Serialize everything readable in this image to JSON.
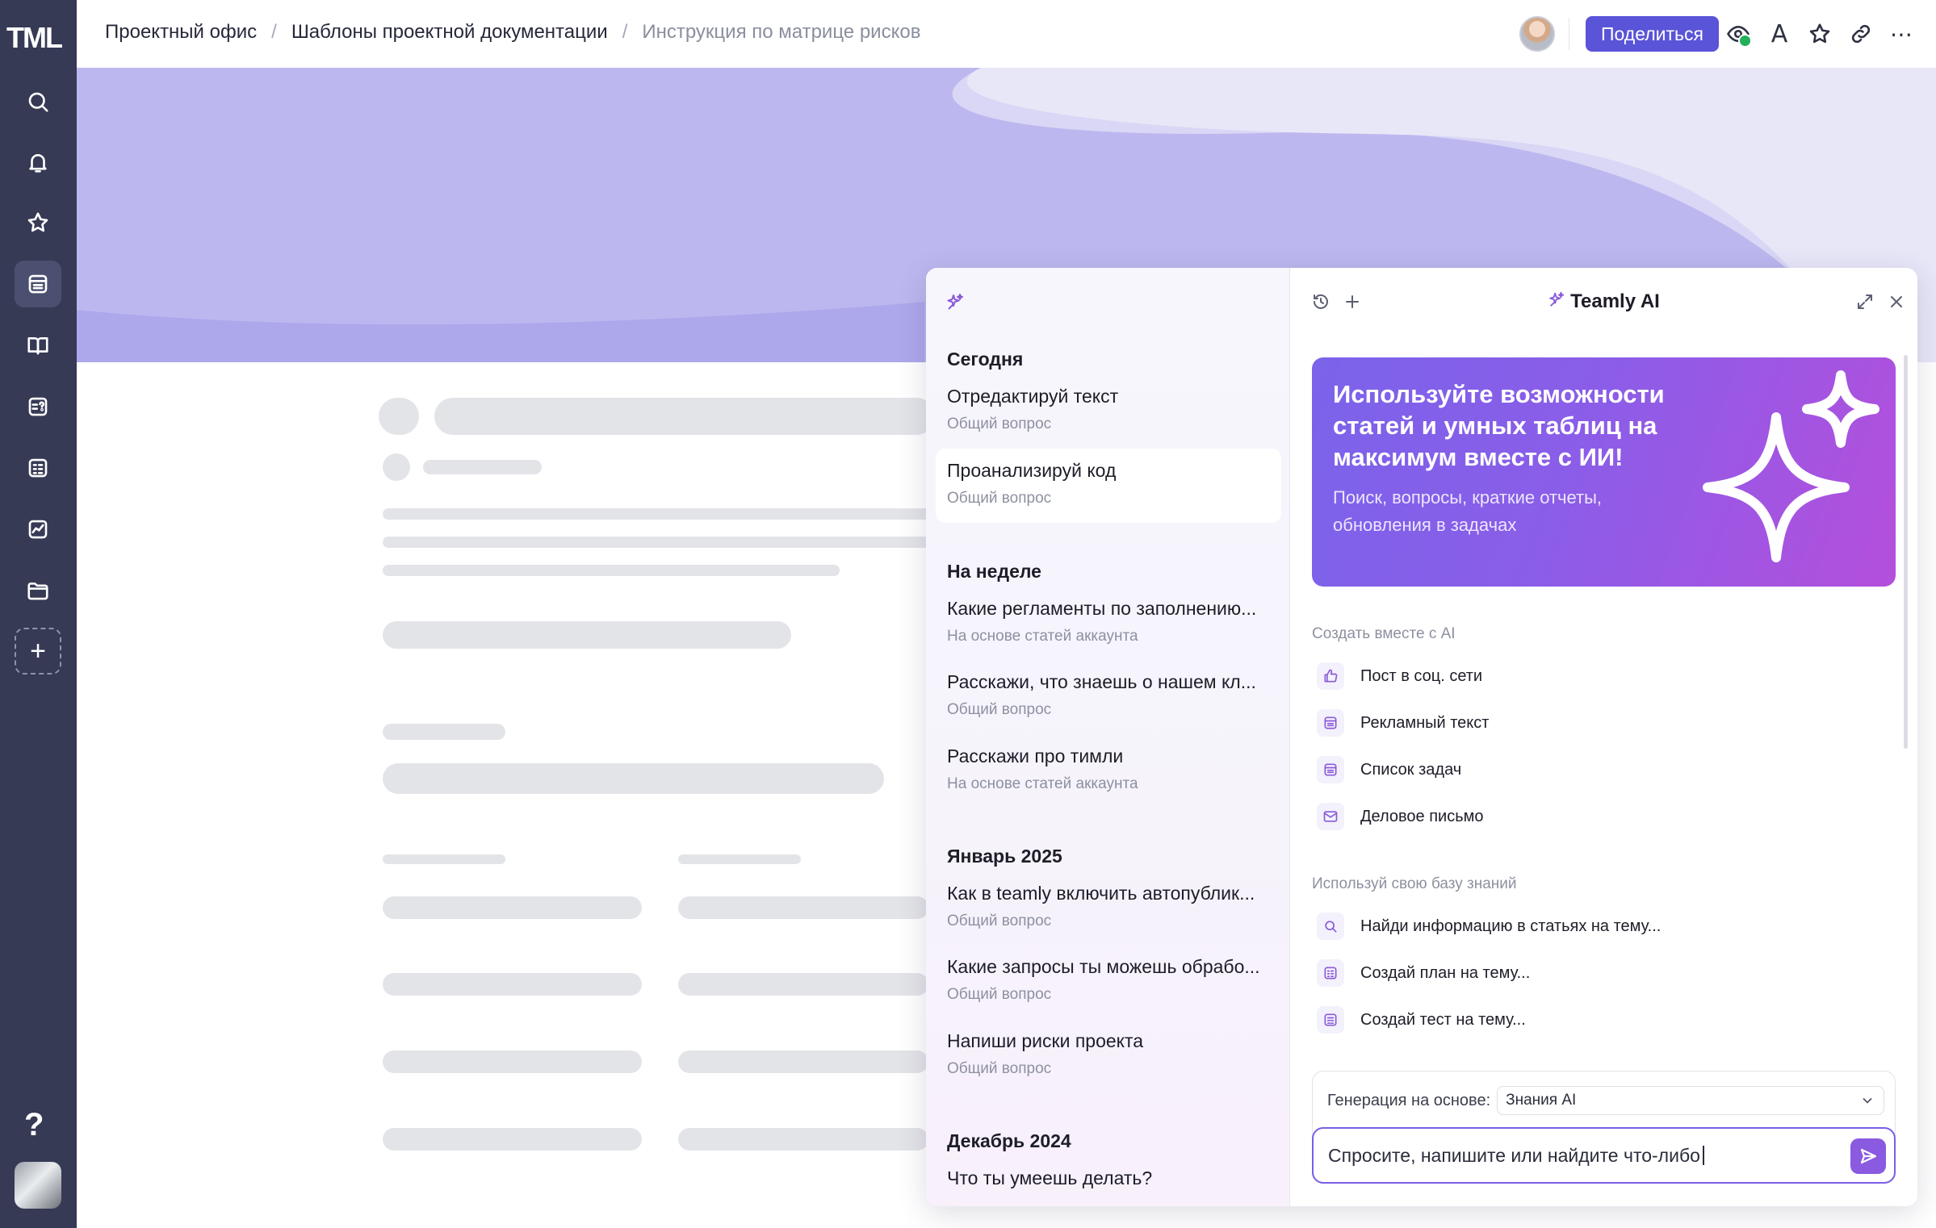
{
  "rail": {
    "logo": "TML",
    "help": "?",
    "add": "+",
    "icons": [
      "search-icon",
      "bell-icon",
      "star-icon",
      "spaces-icon",
      "book-icon",
      "quiz-icon",
      "table-icon",
      "chart-icon",
      "folder-icon"
    ]
  },
  "breadcrumb": {
    "items": [
      "Проектный офис",
      "Шаблоны проектной документации",
      "Инструкция по матрице рисков"
    ],
    "separator": "/"
  },
  "toolbar": {
    "share_label": "Поделиться",
    "text_icon_label": "A",
    "more_label": "⋯"
  },
  "ai": {
    "title": "Teamly AI",
    "history": [
      {
        "section": "Сегодня",
        "items": [
          {
            "title": "Отредактируй текст",
            "subtitle": "Общий вопрос"
          },
          {
            "title": "Проанализируй код",
            "subtitle": "Общий вопрос"
          }
        ]
      },
      {
        "section": "На неделе",
        "items": [
          {
            "title": "Какие регламенты по заполнению...",
            "subtitle": "На основе статей аккаунта"
          },
          {
            "title": "Расскажи, что знаешь о нашем кл...",
            "subtitle": "Общий вопрос"
          },
          {
            "title": "Расскажи про тимли",
            "subtitle": "На основе статей аккаунта"
          }
        ]
      },
      {
        "section": "Январь 2025",
        "items": [
          {
            "title": "Как в teamly включить автопублик...",
            "subtitle": "Общий вопрос"
          },
          {
            "title": "Какие запросы ты можешь обрабо...",
            "subtitle": "Общий вопрос"
          },
          {
            "title": "Напиши риски проекта",
            "subtitle": "Общий вопрос"
          }
        ]
      },
      {
        "section": "Декабрь 2024",
        "items": [
          {
            "title": "Что ты умеешь делать?",
            "subtitle": ""
          }
        ]
      }
    ],
    "promo": {
      "title": "Используйте возможности статей и умных таблиц на максимум вместе с ИИ!",
      "subtitle": "Поиск, вопросы, краткие отчеты, обновления в задачах"
    },
    "create_group": {
      "title": "Создать вместе с AI",
      "items": [
        "Пост в соц. сети",
        "Рекламный текст",
        "Список задач",
        "Деловое письмо"
      ]
    },
    "knowledge_group": {
      "title": "Используй свою базу знаний",
      "items": [
        "Найди информацию в статьях на тему...",
        "Создай план на тему...",
        "Создай тест на тему..."
      ]
    },
    "composer": {
      "gen_label": "Генерация на основе:",
      "gen_value": "Знания AI",
      "prompt_text": "Спросите, напишите или найдите что-либо"
    }
  },
  "colors": {
    "rail": "#363a55",
    "accent": "#5a54d8",
    "ai_gradient_start": "#7b63ea",
    "ai_gradient_end": "#b44fdc",
    "cover": "#bcb8ef"
  }
}
